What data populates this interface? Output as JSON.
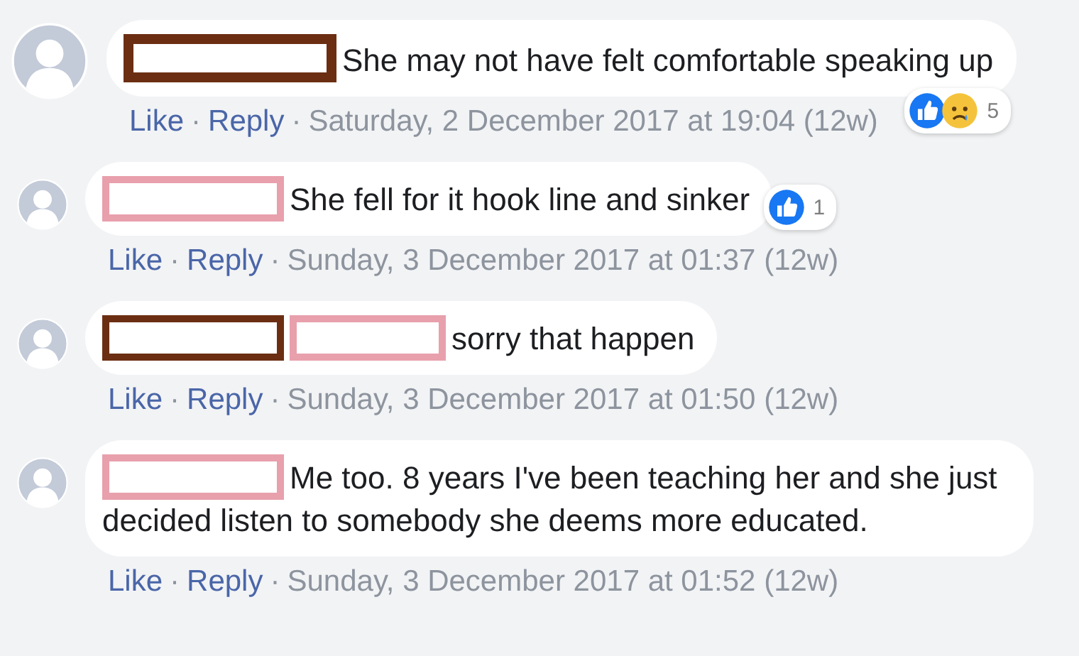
{
  "comments": [
    {
      "kind": "comment",
      "redactions": [
        {
          "color": "#6b2e12"
        }
      ],
      "text": "She may not have felt comfortable speaking up",
      "actions": [
        "Like",
        "Reply"
      ],
      "separator": "·",
      "timestamp": "Saturday, 2 December 2017 at 19:04 (12w)",
      "reactions": {
        "icons": [
          {
            "kind": "like"
          },
          {
            "kind": "sad"
          }
        ],
        "count": "5"
      }
    },
    {
      "kind": "reply",
      "redactions": [
        {
          "color": "#e8a0ac"
        }
      ],
      "text": "She fell for it hook line and sinker",
      "actions": [
        "Like",
        "Reply"
      ],
      "separator": "·",
      "timestamp": "Sunday, 3 December 2017 at 01:37 (12w)",
      "reactions": {
        "icons": [
          {
            "kind": "like"
          }
        ],
        "count": "1"
      }
    },
    {
      "kind": "reply",
      "redactions": [
        {
          "color": "#6b2e12"
        },
        {
          "color": "#e8a0ac"
        }
      ],
      "text": "sorry that happen",
      "actions": [
        "Like",
        "Reply"
      ],
      "separator": "·",
      "timestamp": "Sunday, 3 December 2017 at 01:50 (12w)"
    },
    {
      "kind": "reply",
      "redactions": [
        {
          "color": "#e8a0ac"
        }
      ],
      "text": "Me too. 8 years I've been teaching her and she just decided listen to somebody she deems more educated.",
      "actions": [
        "Like",
        "Reply"
      ],
      "separator": "·",
      "timestamp": "Sunday, 3 December 2017 at 01:52 (12w)"
    }
  ]
}
